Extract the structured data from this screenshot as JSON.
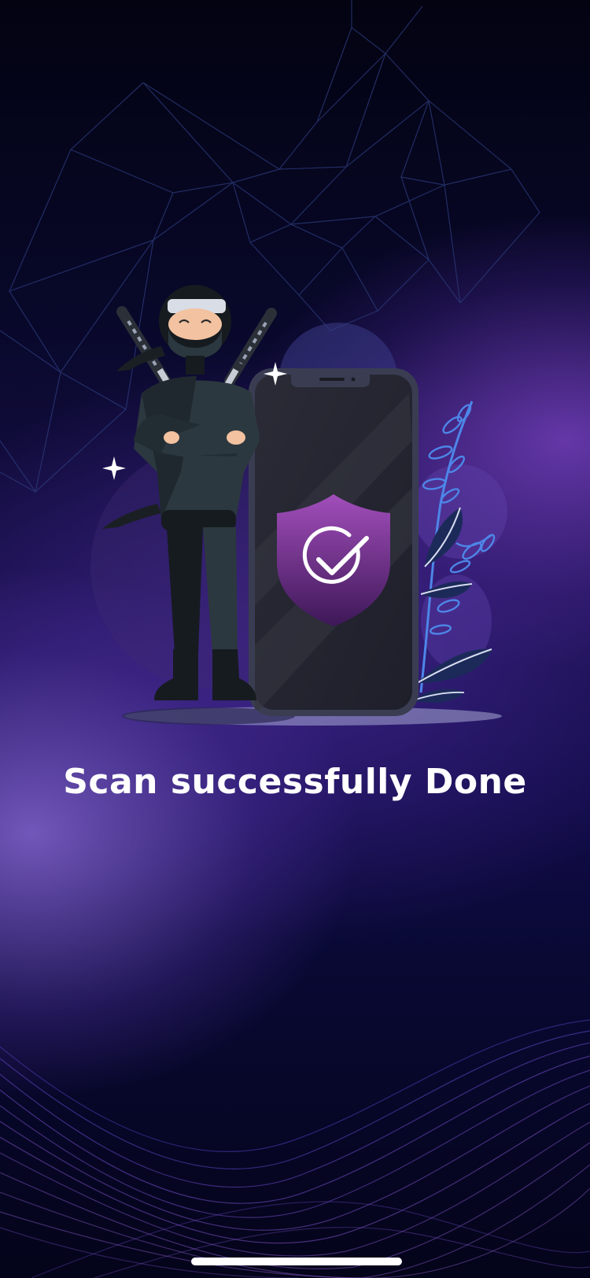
{
  "screen": {
    "title": "Scan successfully Done"
  },
  "colors": {
    "background_top": "#030312",
    "background_mid": "#1b1150",
    "accent_purple": "#7a55c8",
    "shield_top": "#9b4db6",
    "shield_bottom": "#4a1f66",
    "phone_body": "#2a2c3a",
    "text": "#ffffff"
  },
  "icons": {
    "shield_check": "shield-check-icon",
    "sparkle": "sparkle-icon"
  }
}
